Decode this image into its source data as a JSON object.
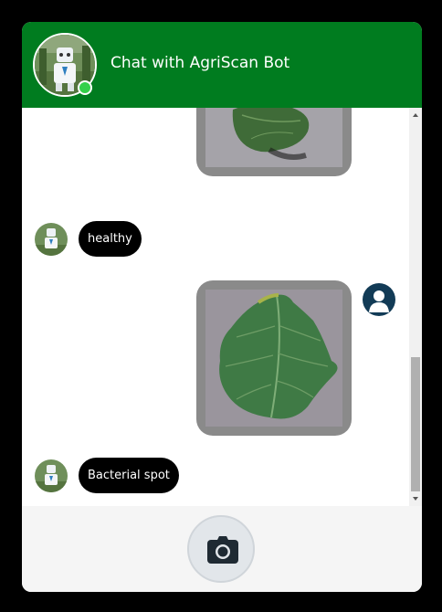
{
  "header": {
    "title": "Chat with AgriScan Bot",
    "bot_avatar_icon": "robot-avatar",
    "status": "online",
    "status_color": "#33d04a",
    "background_color": "#007c1f"
  },
  "messages": [
    {
      "sender": "user",
      "type": "image",
      "content": "leaf-photo",
      "partially_visible": true
    },
    {
      "sender": "bot",
      "type": "text",
      "text": "healthy"
    },
    {
      "sender": "user",
      "type": "image",
      "content": "leaf-photo"
    },
    {
      "sender": "bot",
      "type": "text",
      "text": "Bacterial spot"
    }
  ],
  "footer": {
    "camera_button_icon": "camera-icon"
  }
}
